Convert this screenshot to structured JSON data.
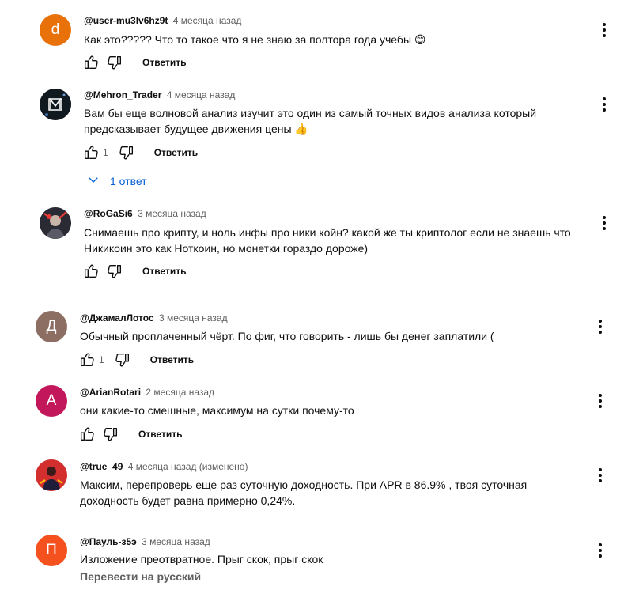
{
  "comments": [
    {
      "author": "@user-mu3lv6hz9t",
      "time": "4 месяца назад",
      "text": "Как это????? Что то такое что я не знаю за полтора года учебы 😊",
      "likes": "",
      "reply_label": "Ответить",
      "avatar_letter": "d",
      "avatar_color": "#e8710a"
    },
    {
      "author": "@Mehron_Trader",
      "time": "4 месяца назад",
      "text": "Вам бы еще волновой анализ изучит это один из самый точных видов анализа который предсказывает будущее движения цены 👍",
      "likes": "1",
      "reply_label": "Ответить",
      "avatar_letter": "",
      "avatar_color": "#101820",
      "replies_label": "1 ответ"
    },
    {
      "author": "@RoGaSi6",
      "time": "3 месяца назад",
      "text": "Снимаешь про крипту, и ноль инфы про ники койн? какой же ты криптолог если не знаешь что Никикоин это как Ноткоин, но монетки гораздо дороже)",
      "likes": "",
      "reply_label": "Ответить",
      "avatar_letter": "",
      "avatar_color": "#2a2a35"
    },
    {
      "author": "@ДжамалЛотос",
      "time": "3 месяца назад",
      "text": "Обычный проплаченный чёрт. По фиг, что говорить - лишь бы денег заплатили (",
      "likes": "1",
      "reply_label": "Ответить",
      "avatar_letter": "Д",
      "avatar_color": "#8d6e63"
    },
    {
      "author": "@ArianRotari",
      "time": "2 месяца назад",
      "text": "они какие-то смешные, максимум на сутки почему-то",
      "likes": "",
      "reply_label": "Ответить",
      "avatar_letter": "A",
      "avatar_color": "#c2185b"
    },
    {
      "author": "@true_49",
      "time": "4 месяца назад (изменено)",
      "text": "Максим, перепроверь еще раз суточную доходность. При APR в 86.9% , твоя суточная доходность будет равна примерно 0,24%.",
      "likes": "",
      "reply_label": "",
      "avatar_letter": "",
      "avatar_color": "#d32f2f"
    },
    {
      "author": "@Пауль-з5э",
      "time": "3 месяца назад",
      "text": "Изложение преотвратное. Прыг скок, прыг скок",
      "likes": "",
      "reply_label": "",
      "avatar_letter": "П",
      "avatar_color": "#f4511e",
      "translate_label": "Перевести на русский"
    }
  ]
}
